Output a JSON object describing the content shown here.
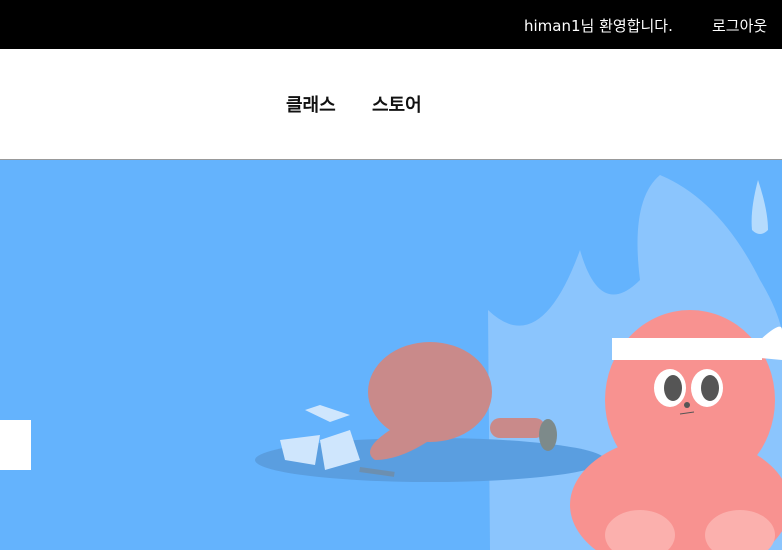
{
  "topbar": {
    "welcome": "himan1님 환영합니다.",
    "logout": "로그아웃"
  },
  "nav": {
    "items": [
      {
        "label": "클래스"
      },
      {
        "label": "스토어"
      }
    ]
  },
  "colors": {
    "hero_bg": "#64b3fd",
    "character": "#f89290"
  }
}
